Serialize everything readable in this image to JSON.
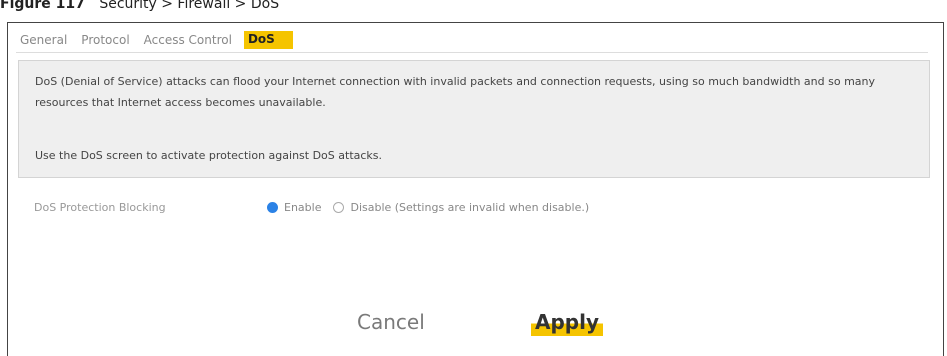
{
  "caption": {
    "figure": "Figure 117",
    "path": "Security > Firewall > DoS"
  },
  "tabs": [
    {
      "label": "General"
    },
    {
      "label": "Protocol"
    },
    {
      "label": "Access Control"
    },
    {
      "label": "DoS"
    }
  ],
  "info": {
    "paragraph1": "DoS (Denial of Service) attacks can flood your Internet connection with invalid packets and connection requests, using so much bandwidth and so many resources that Internet access becomes unavailable.",
    "paragraph2": "Use the DoS screen to activate protection against DoS attacks."
  },
  "dos_protection": {
    "label": "DoS Protection Blocking",
    "options": [
      {
        "label": "Enable",
        "selected": true
      },
      {
        "label": "Disable (Settings are invalid when disable.)",
        "selected": false
      }
    ]
  },
  "buttons": {
    "cancel": "Cancel",
    "apply": "Apply"
  },
  "colors": {
    "accent": "#f5c400",
    "radio_selected": "#2b82e6"
  }
}
